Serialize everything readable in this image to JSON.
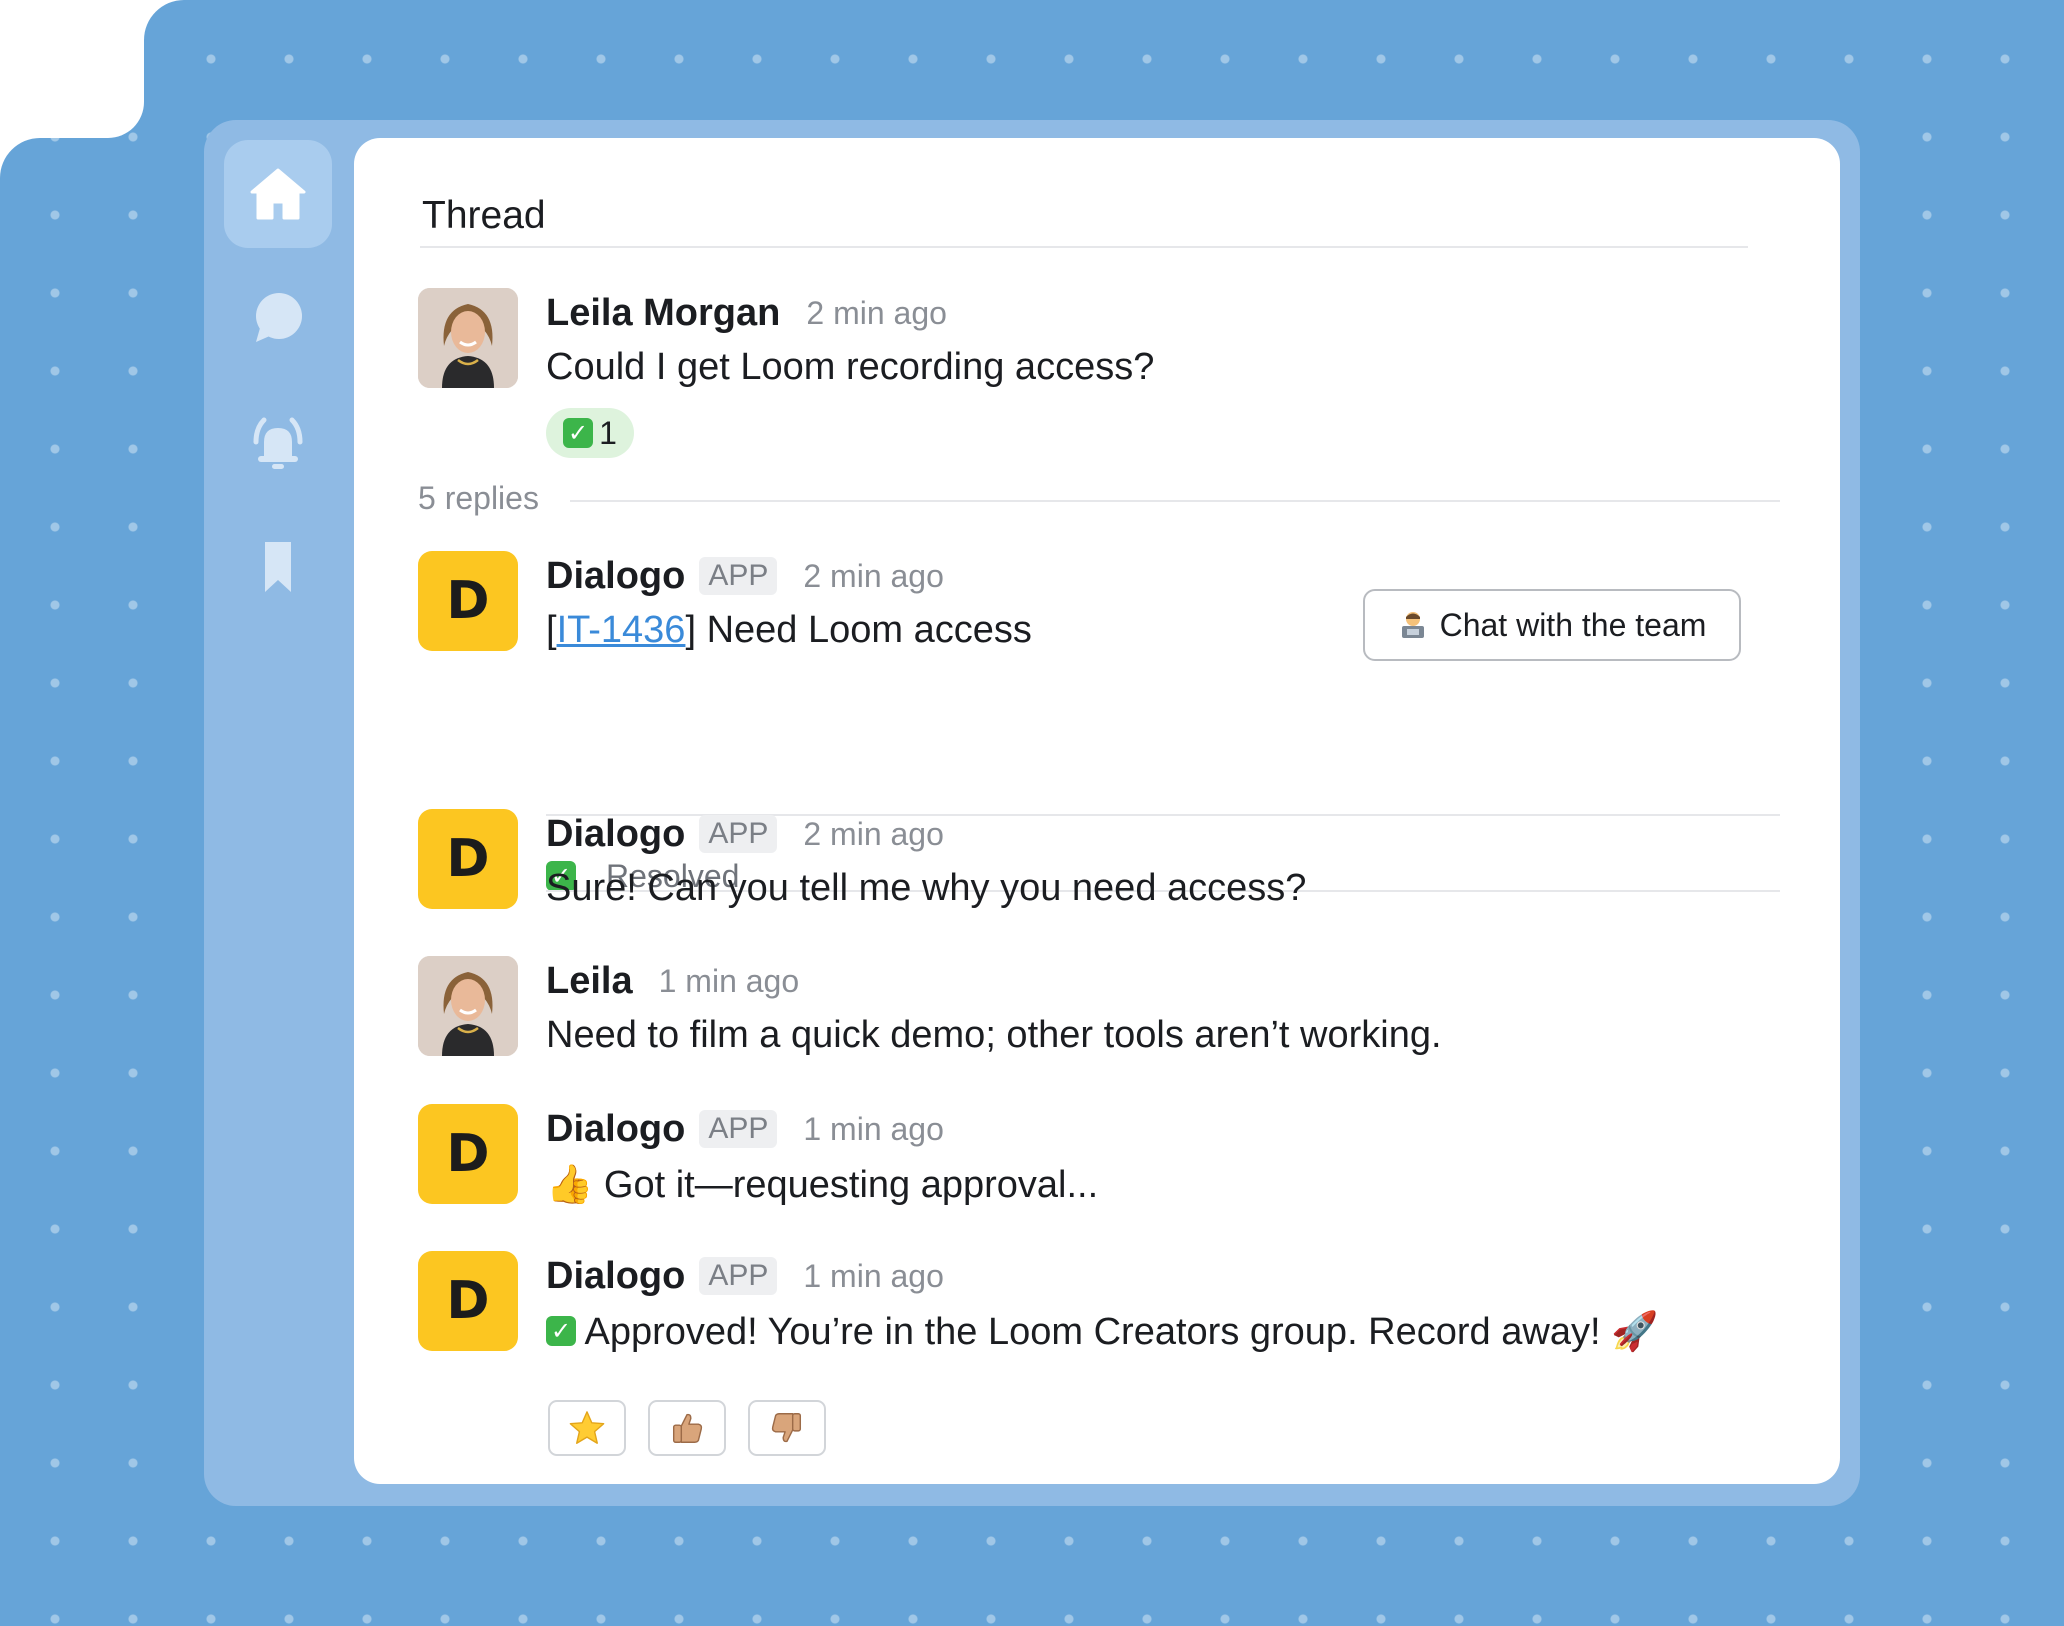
{
  "sidebar": {
    "items": [
      {
        "icon": "home-icon",
        "active": true
      },
      {
        "icon": "chat-bubble-icon",
        "active": false
      },
      {
        "icon": "alarm-bell-icon",
        "active": false
      },
      {
        "icon": "bookmark-icon",
        "active": false
      }
    ]
  },
  "thread": {
    "title": "Thread",
    "replies_label": "5 replies",
    "root": {
      "author": "Leila Morgan",
      "time": "2 min ago",
      "text": "Could I get Loom recording access?",
      "reaction": {
        "icon": "check-mark-emoji",
        "count": "1"
      }
    },
    "messages": [
      {
        "author": "Dialogo",
        "badge": "APP",
        "time": "2 min ago",
        "ticket_open": "[",
        "ticket_id": "IT-1436",
        "ticket_close": "]",
        "ticket_text": "Need Loom access",
        "action_button": {
          "icon": "technologist-emoji",
          "label": "Chat with the team"
        },
        "status": {
          "icon": "check-mark-emoji",
          "label": "Resolved"
        }
      },
      {
        "author": "Dialogo",
        "badge": "APP",
        "time": "2 min ago",
        "text": "Sure! Can you tell me why you need access?"
      },
      {
        "author": "Leila",
        "time": "1 min ago",
        "text": "Need to film a quick demo; other tools aren’t working."
      },
      {
        "author": "Dialogo",
        "badge": "APP",
        "time": "1 min ago",
        "emoji": "👍",
        "text": "Got it—requesting approval..."
      },
      {
        "author": "Dialogo",
        "badge": "APP",
        "time": "1 min ago",
        "text": "Approved! You’re in the Loom Creators group. Record away!",
        "emoji_after": "🚀"
      }
    ],
    "bot_avatar_letter": "D",
    "feedback": [
      "star-icon",
      "thumbs-up-icon",
      "thumbs-down-icon"
    ]
  },
  "colors": {
    "background": "#66a4d8",
    "frame": "#8fbae4",
    "bot_avatar": "#fcc621",
    "link": "#3a8ad9",
    "success": "#3cb54a"
  }
}
